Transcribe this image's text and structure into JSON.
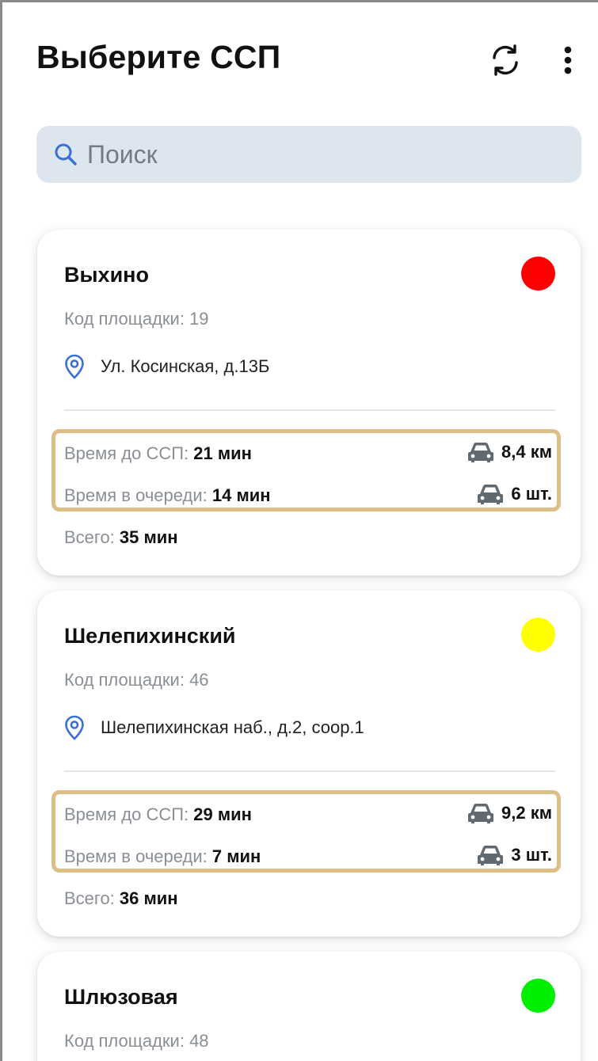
{
  "header": {
    "title": "Выберите ССП"
  },
  "search": {
    "placeholder": "Поиск"
  },
  "labels": {
    "code": "Код площадки: ",
    "time_to": "Время до ССП: ",
    "time_queue": "Время в очереди: ",
    "total": "Всего: "
  },
  "icons": {
    "refresh": "refresh-icon",
    "more": "more-vertical-icon",
    "search": "search-icon",
    "location": "location-pin-icon",
    "car": "car-icon"
  },
  "colors": {
    "red": "#ff0000",
    "yellow": "#ffff00",
    "green": "#00ee00",
    "highlight": "#dcbf86",
    "search_bg": "#dde6ef",
    "pin": "#3a6fd8"
  },
  "sites": [
    {
      "name": "Выхино",
      "status_color": "#ff0000",
      "code": "19",
      "address": "Ул. Косинская, д.13Б",
      "time_to": "21 мин",
      "distance": "8,4 км",
      "time_queue": "14 мин",
      "queue_count": "6 шт.",
      "total": "35 мин"
    },
    {
      "name": "Шелепихинский",
      "status_color": "#ffff00",
      "code": "46",
      "address": "Шелепихинская наб., д.2, соор.1",
      "time_to": "29 мин",
      "distance": "9,2 км",
      "time_queue": "7 мин",
      "queue_count": "3 шт.",
      "total": "36 мин"
    },
    {
      "name": "Шлюзовая",
      "status_color": "#00ee00",
      "code": "48"
    }
  ]
}
